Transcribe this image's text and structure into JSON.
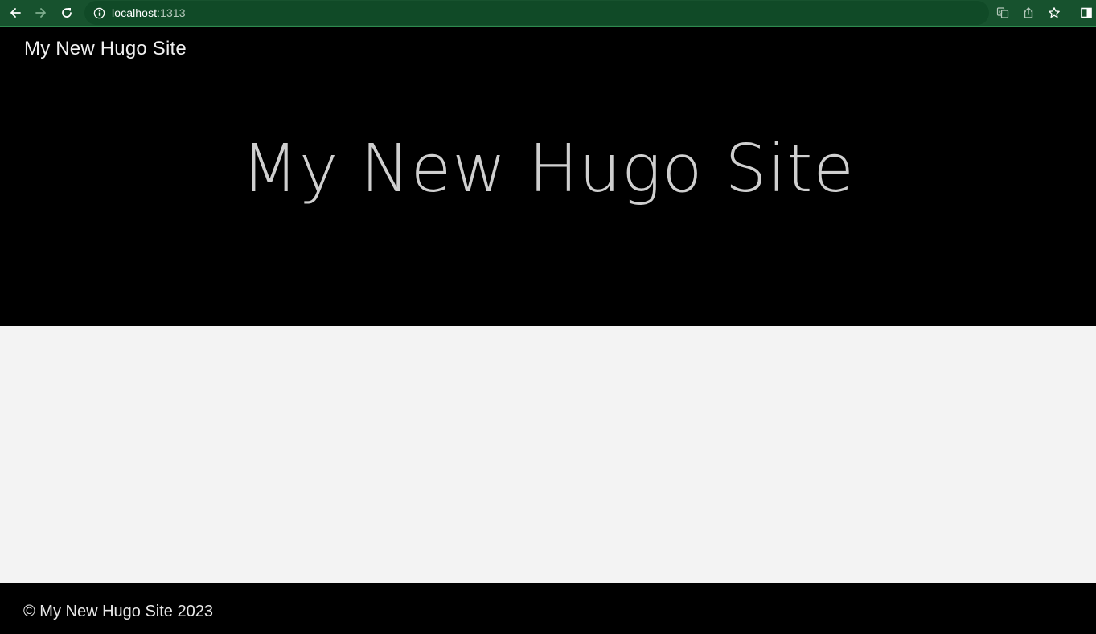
{
  "browser": {
    "url_host": "localhost",
    "url_port": ":1313",
    "icons": [
      "back-arrow-icon",
      "forward-arrow-icon",
      "reload-icon",
      "info-icon",
      "translate-icon",
      "share-icon",
      "star-icon",
      "sidebar-icon"
    ],
    "colors": {
      "toolbar": "#17522e",
      "urlbar": "#104a27"
    }
  },
  "site": {
    "brand": "My New Hugo Site",
    "hero_title": "My New Hugo Site",
    "footer": "© My New Hugo Site 2023"
  },
  "colors": {
    "hero_bg": "#000000",
    "content_bg": "#f3f3f3",
    "footer_bg": "#000000"
  }
}
